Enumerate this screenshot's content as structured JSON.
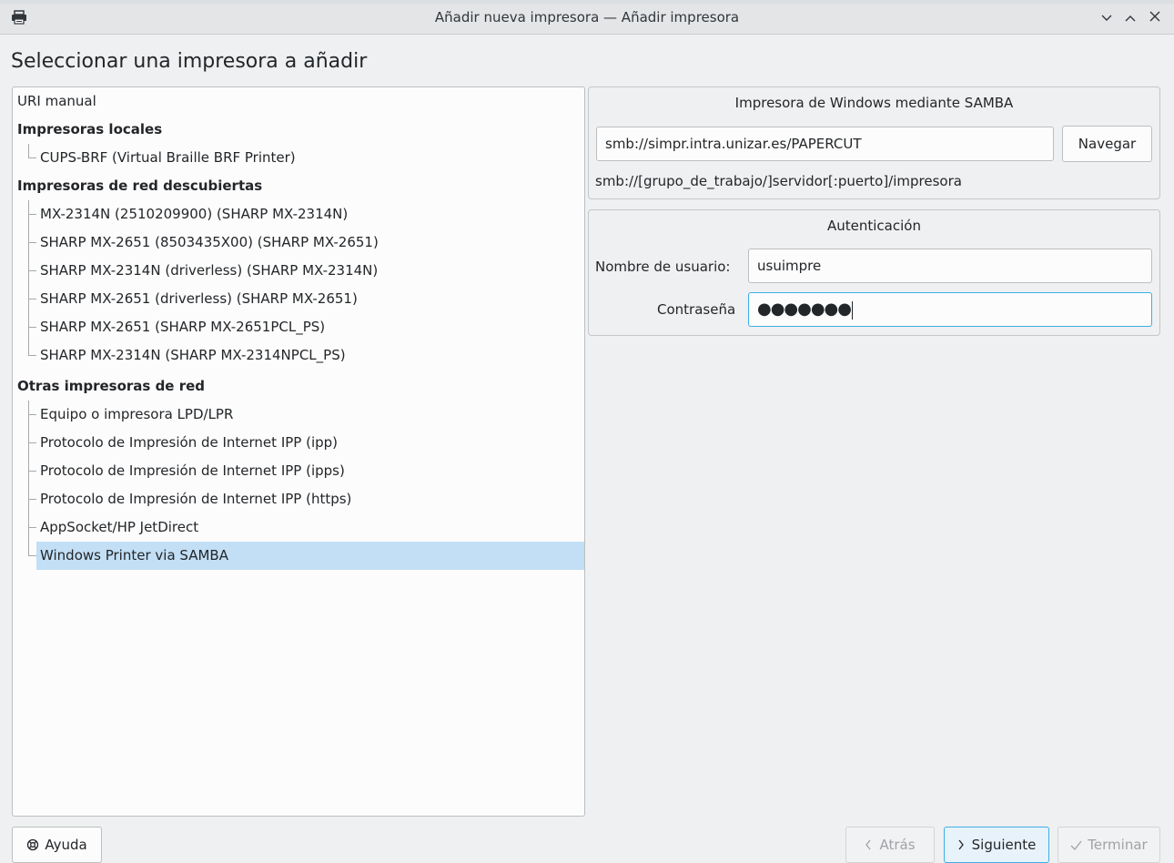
{
  "window": {
    "title": "Añadir nueva impresora — Añadir impresora",
    "minimize_icon": "chevron-down-icon",
    "maximize_icon": "chevron-up-icon",
    "close_icon": "close-icon"
  },
  "heading": "Seleccionar una impresora a añadir",
  "tree": {
    "manual_uri": "URI manual",
    "local": {
      "label": "Impresoras locales",
      "items": [
        "CUPS-BRF (Virtual Braille BRF Printer)"
      ]
    },
    "discovered": {
      "label": "Impresoras de red descubiertas",
      "items": [
        "MX-2314N (2510209900) (SHARP MX-2314N)",
        "SHARP MX-2651 (8503435X00) (SHARP MX-2651)",
        "SHARP MX-2314N (driverless) (SHARP MX-2314N)",
        "SHARP MX-2651 (driverless) (SHARP MX-2651)",
        "SHARP MX-2651 (SHARP MX-2651PCL_PS)",
        "SHARP MX-2314N (SHARP MX-2314NPCL_PS)"
      ]
    },
    "other": {
      "label": "Otras impresoras de red",
      "items": [
        "Equipo o impresora LPD/LPR",
        "Protocolo de Impresión de Internet IPP (ipp)",
        "Protocolo de Impresión de Internet IPP (ipps)",
        "Protocolo de Impresión de Internet IPP (https)",
        "AppSocket/HP JetDirect",
        "Windows Printer via SAMBA"
      ]
    },
    "selected": "Windows Printer via SAMBA"
  },
  "samba": {
    "title": "Impresora de Windows mediante SAMBA",
    "uri_value": "smb://simpr.intra.unizar.es/PAPERCUT",
    "browse_label": "Navegar",
    "hint": "smb://[grupo_de_trabajo/]servidor[:puerto]/impresora"
  },
  "auth": {
    "title": "Autenticación",
    "username_label": "Nombre de usuario:",
    "username_value": "usuimpre",
    "password_label": "Contraseña",
    "password_mask": "●●●●●●●"
  },
  "footer": {
    "help_label": "Ayuda",
    "back_label": "Atrás",
    "next_label": "Siguiente",
    "finish_label": "Terminar"
  },
  "colors": {
    "selection": "#c2dff5",
    "focus": "#3daee9"
  }
}
